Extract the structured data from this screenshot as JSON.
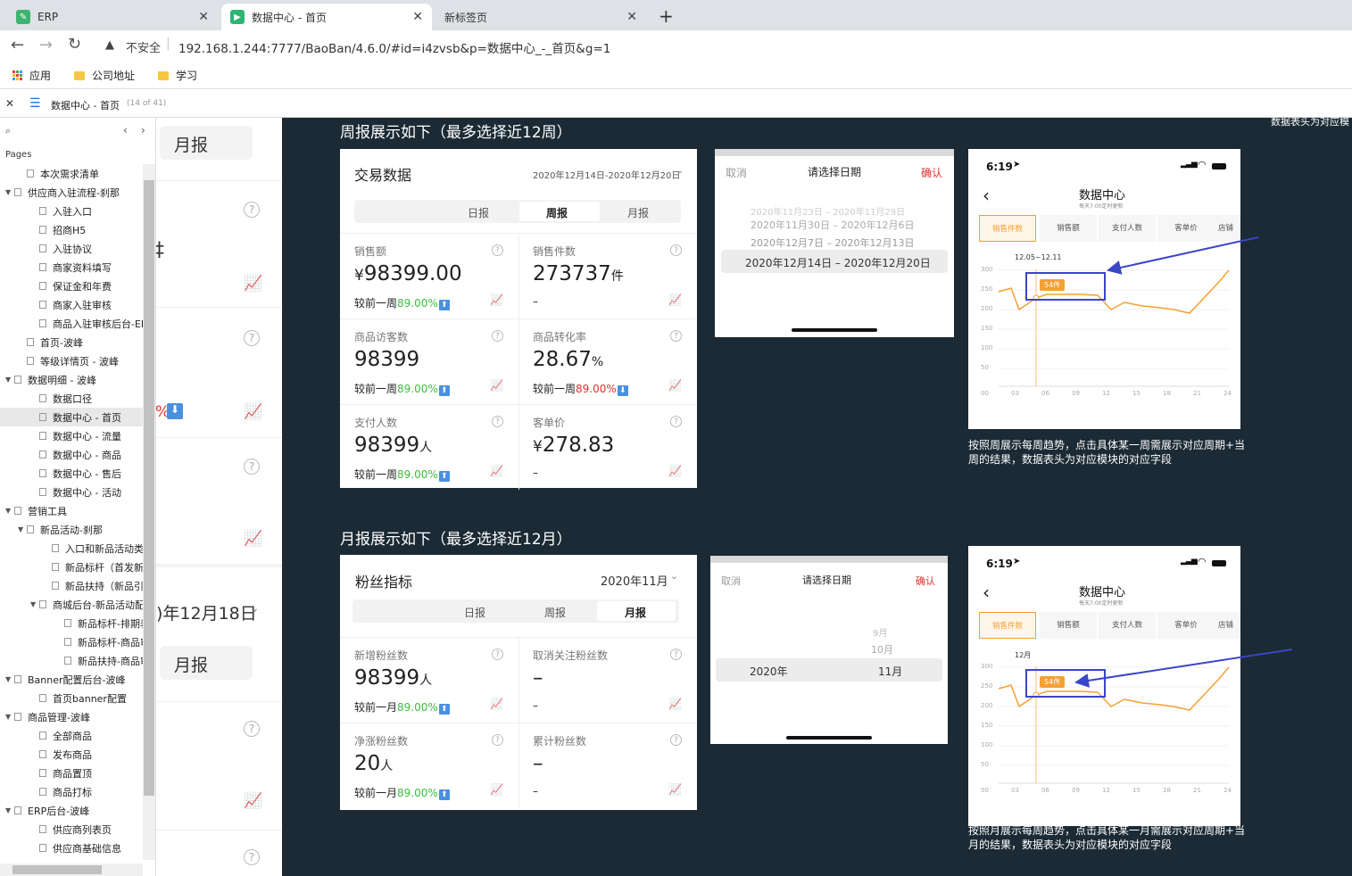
{
  "browser": {
    "tabs": [
      {
        "title": "ERP"
      },
      {
        "title": "数据中心 - 首页"
      },
      {
        "title": "新标签页"
      }
    ],
    "security_label": "不安全",
    "url": "192.168.1.244:7777/BaoBan/4.6.0/#id=i4zvsb&p=数据中心_-_首页&g=1",
    "bookmarks": [
      "应用",
      "公司地址",
      "学习"
    ]
  },
  "app": {
    "page_title": "数据中心 - 首页",
    "page_count": "(14 of 41)",
    "pages_header": "Pages"
  },
  "pages": [
    {
      "label": "本次需求清单",
      "indent": 1,
      "caret": ""
    },
    {
      "label": "供应商入驻流程-刹那",
      "indent": 0,
      "caret": "▼"
    },
    {
      "label": "入驻入口",
      "indent": 2,
      "caret": ""
    },
    {
      "label": "招商H5",
      "indent": 2,
      "caret": ""
    },
    {
      "label": "入驻协议",
      "indent": 2,
      "caret": ""
    },
    {
      "label": "商家资料填写",
      "indent": 2,
      "caret": ""
    },
    {
      "label": "保证金和年费",
      "indent": 2,
      "caret": ""
    },
    {
      "label": "商家入驻审核",
      "indent": 2,
      "caret": ""
    },
    {
      "label": "商品入驻审核后台-ERP",
      "indent": 2,
      "caret": ""
    },
    {
      "label": "首页-波峰",
      "indent": 1,
      "caret": ""
    },
    {
      "label": "等级详情页 - 波峰",
      "indent": 1,
      "caret": ""
    },
    {
      "label": "数据明细 - 波峰",
      "indent": 0,
      "caret": "▼"
    },
    {
      "label": "数据口径",
      "indent": 2,
      "caret": ""
    },
    {
      "label": "数据中心 - 首页",
      "indent": 2,
      "caret": "",
      "selected": true
    },
    {
      "label": "数据中心 - 流量",
      "indent": 2,
      "caret": ""
    },
    {
      "label": "数据中心 - 商品",
      "indent": 2,
      "caret": ""
    },
    {
      "label": "数据中心 - 售后",
      "indent": 2,
      "caret": ""
    },
    {
      "label": "数据中心 - 活动",
      "indent": 2,
      "caret": ""
    },
    {
      "label": "营销工具",
      "indent": 0,
      "caret": "▼"
    },
    {
      "label": "新品活动-刹那",
      "indent": 1,
      "caret": "▼"
    },
    {
      "label": "入口和新品活动类型",
      "indent": 3,
      "caret": ""
    },
    {
      "label": "新品标杆（首发新品",
      "indent": 3,
      "caret": ""
    },
    {
      "label": "新品扶持（新品引流",
      "indent": 3,
      "caret": ""
    },
    {
      "label": "商城后台-新品活动配",
      "indent": 2,
      "caret": "▼"
    },
    {
      "label": "新品标杆-排期表",
      "indent": 4,
      "caret": ""
    },
    {
      "label": "新品标杆-商品审核",
      "indent": 4,
      "caret": ""
    },
    {
      "label": "新品扶持-商品审核",
      "indent": 4,
      "caret": ""
    },
    {
      "label": "Banner配置后台-波峰",
      "indent": 0,
      "caret": "▼"
    },
    {
      "label": "首页banner配置",
      "indent": 2,
      "caret": ""
    },
    {
      "label": "商品管理-波峰",
      "indent": 0,
      "caret": "▼"
    },
    {
      "label": "全部商品",
      "indent": 2,
      "caret": ""
    },
    {
      "label": "发布商品",
      "indent": 2,
      "caret": ""
    },
    {
      "label": "商品置顶",
      "indent": 2,
      "caret": ""
    },
    {
      "label": "商品打标",
      "indent": 2,
      "caret": ""
    },
    {
      "label": "ERP后台-波峰",
      "indent": 0,
      "caret": "▼"
    },
    {
      "label": "供应商列表页",
      "indent": 2,
      "caret": ""
    },
    {
      "label": "供应商基础信息",
      "indent": 2,
      "caret": ""
    }
  ],
  "preview": {
    "month_btn": "月报",
    "month_btn2": "月报",
    "date_text": ")年12月18日",
    "frag_char": "‡",
    "pct_frag": "%"
  },
  "weekly": {
    "heading": "周报展示如下（最多选择近12周）",
    "card_title": "交易数据",
    "date_range": "2020年12月14日-2020年12月20日",
    "tabs": [
      "日报",
      "周报",
      "月报"
    ],
    "metrics": [
      {
        "label": "销售额",
        "prefix": "¥",
        "value": "98399.00",
        "unit": "",
        "cmp_prefix": "较前一周",
        "cmp": "89.00%",
        "dir": "up"
      },
      {
        "label": "销售件数",
        "prefix": "",
        "value": "273737",
        "unit": "件",
        "cmp_prefix": "",
        "cmp": "–",
        "dir": ""
      },
      {
        "label": "商品访客数",
        "prefix": "",
        "value": "98399",
        "unit": "",
        "cmp_prefix": "较前一周",
        "cmp": "89.00%",
        "dir": "up"
      },
      {
        "label": "商品转化率",
        "prefix": "",
        "value": "28.67",
        "unit": "%",
        "cmp_prefix": "较前一周",
        "cmp": "89.00%",
        "dir": "down"
      },
      {
        "label": "支付人数",
        "prefix": "",
        "value": "98399",
        "unit": "人",
        "cmp_prefix": "较前一周",
        "cmp": "89.00%",
        "dir": "up"
      },
      {
        "label": "客单价",
        "prefix": "¥",
        "value": "278.83",
        "unit": "",
        "cmp_prefix": "",
        "cmp": "–",
        "dir": ""
      }
    ],
    "picker": {
      "cancel": "取消",
      "title": "请选择日期",
      "confirm": "确认",
      "options": [
        "2020年11月23日 – 2020年11月29日",
        "2020年11月30日 – 2020年12月6日",
        "2020年12月7日 – 2020年12月13日",
        "2020年12月14日 – 2020年12月20日"
      ]
    },
    "phone": {
      "time": "6:19",
      "title": "数据中心",
      "subtitle": "每天7:00定时更新",
      "tabs": [
        "销售件数",
        "销售额",
        "支付人数",
        "客单价",
        "店铺"
      ],
      "marker_label": "12.05~12.11",
      "badge": "54件",
      "y_ticks": [
        "300",
        "250",
        "200",
        "150",
        "100",
        "50"
      ],
      "x_ticks": [
        "00",
        "03",
        "06",
        "09",
        "12",
        "15",
        "18",
        "21",
        "24"
      ]
    },
    "caption": "按照周展示每周趋势，点击具体某一周需展示对应周期+当周的结果，数据表头为对应模块的对应字段"
  },
  "monthly": {
    "heading": "月报展示如下（最多选择近12月）",
    "card_title": "粉丝指标",
    "date": "2020年11月",
    "tabs": [
      "日报",
      "周报",
      "月报"
    ],
    "metrics": [
      {
        "label": "新增粉丝数",
        "value": "98399",
        "unit": "人",
        "cmp_prefix": "较前一月",
        "cmp": "89.00%",
        "dir": "up"
      },
      {
        "label": "取消关注粉丝数",
        "value": "–",
        "unit": "",
        "cmp_prefix": "",
        "cmp": "–",
        "dir": ""
      },
      {
        "label": "净涨粉丝数",
        "value": "20",
        "unit": "人",
        "cmp_prefix": "较前一月",
        "cmp": "89.00%",
        "dir": "up"
      },
      {
        "label": "累计粉丝数",
        "value": "–",
        "unit": "",
        "cmp_prefix": "",
        "cmp": "–",
        "dir": ""
      }
    ],
    "picker": {
      "cancel": "取消",
      "title": "请选择日期",
      "confirm": "确认",
      "year": "2020年",
      "months": [
        "9月",
        "10月",
        "11月"
      ]
    },
    "phone": {
      "time": "6:19",
      "title": "数据中心",
      "subtitle": "每天7:00定时更新",
      "tabs": [
        "销售件数",
        "销售额",
        "支付人数",
        "客单价",
        "店铺"
      ],
      "marker_label": "12月",
      "badge": "54件",
      "y_ticks": [
        "300",
        "250",
        "200",
        "150",
        "100",
        "50"
      ],
      "x_ticks": [
        "00",
        "03",
        "06",
        "09",
        "12",
        "15",
        "18",
        "21",
        "24"
      ]
    },
    "caption": "按照月展示每周趋势，点击具体某一月需展示对应周期+当月的结果，数据表头为对应模块的对应字段"
  },
  "top_right_text": "数据表头为对应模",
  "colors": {
    "accent": "#f5a032",
    "up": "#3cbf3c",
    "down": "#e03030",
    "annotation": "#3a45c8",
    "canvas_bg": "#1b2a34"
  }
}
